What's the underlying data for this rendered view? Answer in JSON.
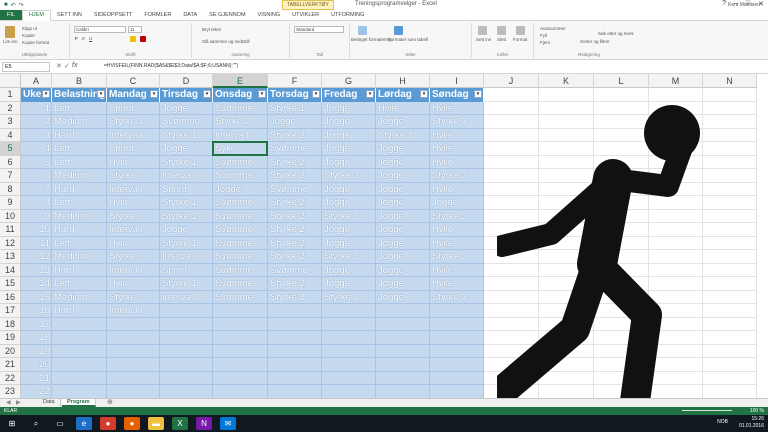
{
  "title_bar": {
    "window_title": "Treningsprogramvelger - Excel",
    "tools_tab": "TABELLVERKTØY",
    "controls": [
      "?",
      "–",
      "□",
      "✕"
    ],
    "qat_icons": [
      "save-icon",
      "undo-icon",
      "redo-icon"
    ]
  },
  "ribbon_tabs": [
    {
      "label": "FIL",
      "kind": "file"
    },
    {
      "label": "HJEM",
      "kind": "active"
    },
    {
      "label": "SETT INN",
      "kind": ""
    },
    {
      "label": "SIDEOPPSETT",
      "kind": ""
    },
    {
      "label": "FORMLER",
      "kind": ""
    },
    {
      "label": "DATA",
      "kind": ""
    },
    {
      "label": "SE GJENNOM",
      "kind": ""
    },
    {
      "label": "VISNING",
      "kind": ""
    },
    {
      "label": "UTVIKLER",
      "kind": ""
    },
    {
      "label": "UTFORMING",
      "kind": ""
    }
  ],
  "user_name": "Kent Mathisen",
  "ribbon": {
    "clipboard": {
      "paste": "Lim inn",
      "cut": "Klipp ut",
      "copy": "Kopier",
      "format_painter": "Kopier format",
      "label": "Utklippstavle"
    },
    "font": {
      "name": "Calibri",
      "size": "11",
      "label": "Skrift",
      "buttons": [
        "F",
        "K",
        "U"
      ]
    },
    "alignment": {
      "wrap": "Bryt tekst",
      "merge": "Slå sammen og midtstill",
      "label": "Justering"
    },
    "number": {
      "format": "Standard",
      "label": "Tall"
    },
    "styles": {
      "conditional": "Betinget formatering",
      "as_table": "Formater som tabell",
      "label": "Stiler"
    },
    "cells": {
      "insert": "Sett inn",
      "delete": "Slett",
      "format": "Format",
      "label": "Celler"
    },
    "editing": {
      "autosum": "Autosummer",
      "fill": "Fyll",
      "clear": "Fjern",
      "sort": "Sorter og filtrer",
      "find": "Søk etter og merk",
      "label": "Redigering"
    }
  },
  "formula_bar": {
    "name_box": "E5",
    "fx_label": "fx",
    "formula": "=HVISFEIL(FINN.RAD($A5&$E$3;Data!$A:$F;6;USANN);\"\")",
    "icons": [
      "cancel-icon",
      "confirm-icon",
      "function-icon"
    ]
  },
  "grid": {
    "columns": [
      "A",
      "B",
      "C",
      "D",
      "E",
      "F",
      "G",
      "H",
      "I",
      "J",
      "K",
      "L",
      "M",
      "N"
    ],
    "selected_column": "E",
    "rows": [
      "1",
      "2",
      "3",
      "4",
      "5",
      "6",
      "7",
      "8",
      "9",
      "10",
      "11",
      "12",
      "13",
      "14",
      "15",
      "16",
      "17",
      "18",
      "19",
      "20",
      "21",
      "22",
      "23"
    ],
    "selected_row": "5",
    "active_cell": "E5"
  },
  "table": {
    "headers": [
      "Uke",
      "Belastning",
      "Mandag",
      "Tirsdag",
      "Onsdag",
      "Torsdag",
      "Fredag",
      "Lørdag",
      "Søndag"
    ],
    "filter_glyph": "▾",
    "rows": [
      [
        "1",
        "Lett",
        "Sprint",
        "Jogge",
        "Svømme",
        "Styrke 1",
        "Jogge",
        "Hvile",
        "Hvile"
      ],
      [
        "2",
        "Medium",
        "Styrke 1",
        "Svømme",
        "Styrke 2",
        "Jogge",
        "Jogge",
        "Jogge",
        "Styrke 3"
      ],
      [
        "3",
        "Hard",
        "Intervall",
        "Styrke 1",
        "Intervall",
        "Styrke 2",
        "Jogge",
        "Styrke 3",
        "Hvile"
      ],
      [
        "4",
        "Lett",
        "Sprint",
        "Jogge",
        "Sykl",
        "Svømme",
        "Jogge",
        "Jogge",
        "Hvile"
      ],
      [
        "5",
        "Lett",
        "Hvile",
        "Styrke 1",
        "Svømme",
        "Styrke 2",
        "Jogge",
        "Jogge",
        "Hvile"
      ],
      [
        "6",
        "Medium",
        "Styrke",
        "Intervall",
        "Svømme",
        "Styrke 2",
        "Styrke 3",
        "Jogge",
        "Styrke 3"
      ],
      [
        "7",
        "Hard",
        "Intervall",
        "Sprint",
        "Jogge",
        "Svømme",
        "Jogge",
        "Jogge",
        "Hvile"
      ],
      [
        "8",
        "Lett",
        "Hvile",
        "Styrke 1",
        "Svømme",
        "Styrke 2",
        "Jogge",
        "Jogge",
        "Jogge"
      ],
      [
        "9",
        "Medium",
        "Styrke",
        "Styrke 1",
        "Svømme",
        "Styrke 2",
        "Styrke 3",
        "Jogge",
        "Styrke 3"
      ],
      [
        "10",
        "Hard",
        "Intervall",
        "Jogge",
        "Svømme",
        "Styrke 2",
        "Jogge",
        "Jogge",
        "Hvile"
      ],
      [
        "11",
        "Lett",
        "Hvile",
        "Styrke 1",
        "Svømme",
        "Styrke 2",
        "Jogge",
        "Jogge",
        "Hvile"
      ],
      [
        "12",
        "Medium",
        "Styrke",
        "Intervall",
        "Svømme",
        "Styrke 2",
        "Styrke 3",
        "Jogge",
        "Styrke 3"
      ],
      [
        "13",
        "Hard",
        "Intervall",
        "Sprint",
        "Svømme",
        "Svømme",
        "Jogge",
        "Jogge",
        "Hvile"
      ],
      [
        "14",
        "Lett",
        "Hvile",
        "Styrke 1",
        "Svømme",
        "Styrke 2",
        "Jogge",
        "Jogge",
        "Hvile"
      ],
      [
        "15",
        "Medium",
        "Styrke",
        "Intervall",
        "Svømme",
        "Styrke 2",
        "Styrke 3",
        "Jogge",
        "Styrke 3"
      ],
      [
        "16",
        "Hard",
        "Intervall",
        "",
        "",
        "",
        "",
        "",
        ""
      ],
      [
        "17",
        "",
        "",
        "",
        "",
        "",
        "",
        "",
        ""
      ],
      [
        "18",
        "",
        "",
        "",
        "",
        "",
        "",
        "",
        ""
      ],
      [
        "19",
        "",
        "",
        "",
        "",
        "",
        "",
        "",
        ""
      ],
      [
        "20",
        "",
        "",
        "",
        "",
        "",
        "",
        "",
        ""
      ],
      [
        "21",
        "",
        "",
        "",
        "",
        "",
        "",
        "",
        ""
      ],
      [
        "22",
        "",
        "",
        "",
        "",
        "",
        "",
        "",
        ""
      ]
    ]
  },
  "colors": {
    "table_header": "#5b9bd5",
    "table_band": "#c5d9ef",
    "excel_green": "#217346",
    "runner": "#111111"
  },
  "runner_icon": "running-person-icon",
  "sheet_tabs": [
    {
      "label": "Data",
      "active": false
    },
    {
      "label": "Program",
      "active": true
    }
  ],
  "add_sheet_glyph": "⊕",
  "status": {
    "ready": "KLAR",
    "zoom": "100 %"
  },
  "taskbar": {
    "icons": [
      "windows-start-icon",
      "search-icon",
      "task-view-icon",
      "edge-icon",
      "chrome-icon",
      "firefox-icon",
      "explorer-icon",
      "excel-icon",
      "onenote-icon",
      "mail-icon"
    ],
    "language": "NOB",
    "time": "15:26",
    "date": "01.01.2016"
  }
}
